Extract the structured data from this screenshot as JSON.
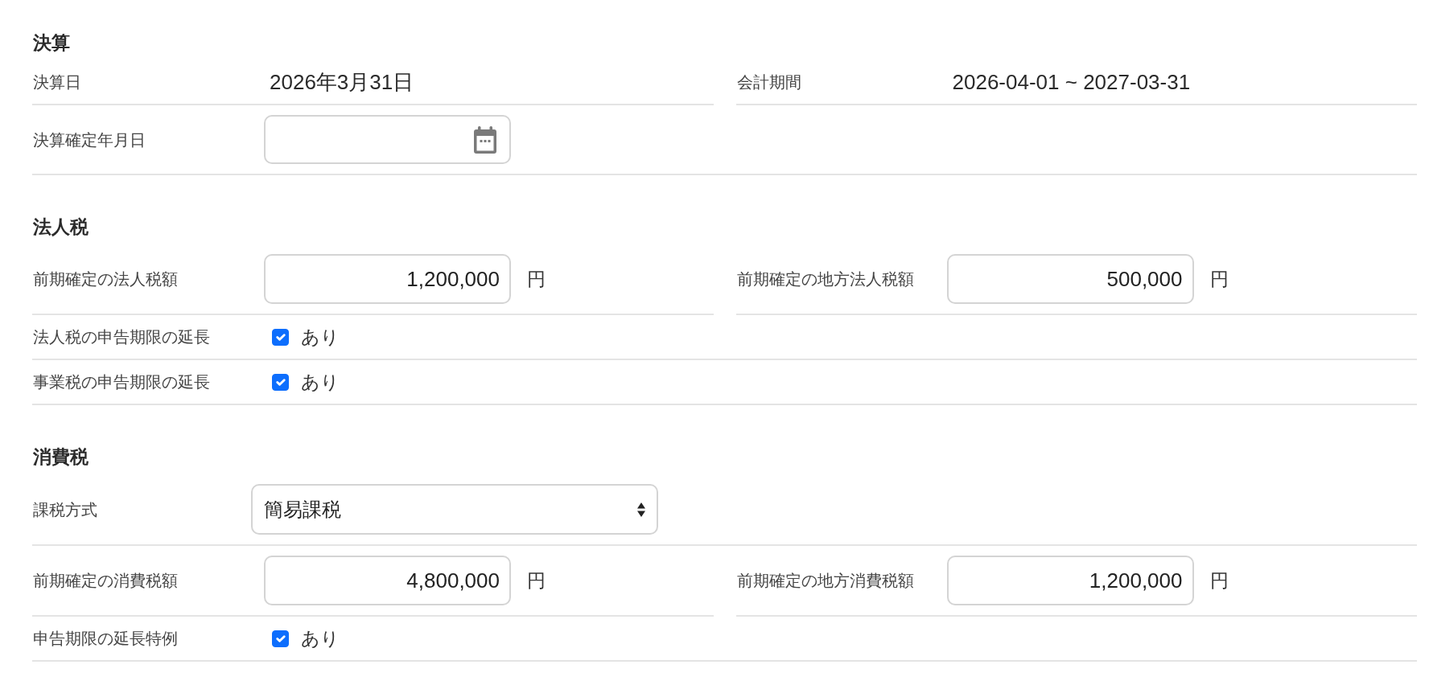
{
  "sections": [
    {
      "title": "決算",
      "rows": [
        {
          "cells": [
            {
              "kind": "text",
              "label": "決算日",
              "value": "2026年3月31日"
            },
            {
              "kind": "text",
              "label": "会計期間",
              "value": "2026-04-01 ~ 2027-03-31"
            }
          ]
        },
        {
          "cells": [
            {
              "kind": "date",
              "label": "決算確定年月日"
            }
          ]
        }
      ]
    },
    {
      "title": "法人税",
      "rows": [
        {
          "cells": [
            {
              "kind": "amount",
              "label": "前期確定の法人税額",
              "value": "1,200,000",
              "unit": "円"
            },
            {
              "kind": "amount",
              "label": "前期確定の地方法人税額",
              "value": "500,000",
              "unit": "円"
            }
          ]
        },
        {
          "cells": [
            {
              "kind": "checkbox",
              "label": "法人税の申告期限の延長",
              "checked": true,
              "text": "あり"
            }
          ]
        },
        {
          "cells": [
            {
              "kind": "checkbox",
              "label": "事業税の申告期限の延長",
              "checked": true,
              "text": "あり"
            }
          ]
        }
      ]
    },
    {
      "title": "消費税",
      "rows": [
        {
          "cells": [
            {
              "kind": "select",
              "label": "課税方式",
              "value": "簡易課税"
            }
          ]
        },
        {
          "cells": [
            {
              "kind": "amount",
              "label": "前期確定の消費税額",
              "value": "4,800,000",
              "unit": "円"
            },
            {
              "kind": "amount",
              "label": "前期確定の地方消費税額",
              "value": "1,200,000",
              "unit": "円"
            }
          ]
        },
        {
          "cells": [
            {
              "kind": "checkbox",
              "label": "申告期限の延長特例",
              "checked": true,
              "text": "あり"
            }
          ]
        }
      ]
    }
  ]
}
